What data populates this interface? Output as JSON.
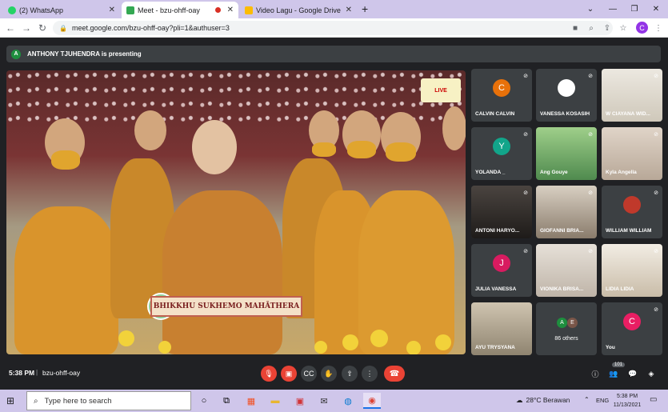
{
  "browser": {
    "tabs": [
      {
        "title": "(2) WhatsApp",
        "icon": "whatsapp-icon",
        "favicon_color": "#25d366",
        "active": false
      },
      {
        "title": "Meet - bzu-ohff-oay",
        "icon": "meet-icon",
        "favicon_color": "#34a853",
        "active": true
      },
      {
        "title": "Video Lagu - Google Drive",
        "icon": "drive-icon",
        "favicon_color": "#fbbc04",
        "active": false
      }
    ],
    "new_tab": "+",
    "url": "meet.google.com/bzu-ohff-oay?pli=1&authuser=3",
    "profile_initial": "C"
  },
  "meet": {
    "presenting": "ANTHONY TJUHENDRA is presenting",
    "presenter_initial": "A",
    "main_video": {
      "live_badge": "LIVE",
      "nameplate": "BHIKKHU SUKHEMO MAHĀTHERA"
    },
    "participants": [
      {
        "name": "CALVIN CALVIN",
        "initial": "C",
        "color": "#e8710a",
        "kind": "avatar"
      },
      {
        "name": "VANESSA KOSASIH",
        "initial": "",
        "color": "#ffffff",
        "kind": "avatar"
      },
      {
        "name": "W CIAYANA WID...",
        "kind": "video",
        "color": "#d8d2c4"
      },
      {
        "name": "YOLANDA _",
        "initial": "Y",
        "color": "#12a58a",
        "kind": "avatar"
      },
      {
        "name": "Ang Gouye",
        "kind": "video",
        "color": "#7fb87a"
      },
      {
        "name": "Kyla Angella",
        "kind": "video",
        "color": "#c9b8a8"
      },
      {
        "name": "ANTONI HARYO...",
        "kind": "video",
        "color": "#2d2a28"
      },
      {
        "name": "GIOFANNI BRIA...",
        "kind": "video",
        "color": "#b8aa98"
      },
      {
        "name": "WILLIAM WILLIAM",
        "kind": "avatar-photo",
        "color": "#c0392b"
      },
      {
        "name": "JULIA VANESSA",
        "initial": "J",
        "color": "#d81b60",
        "kind": "avatar"
      },
      {
        "name": "VIONIKA BRISA...",
        "kind": "video",
        "color": "#d6cfc6"
      },
      {
        "name": "LIDIA LIDIA",
        "kind": "video",
        "color": "#e8e2d8"
      },
      {
        "name": "AYU TRYSYANA",
        "kind": "video",
        "color": "#b7ab96"
      },
      {
        "name": "86 others",
        "initials": [
          "A",
          "E"
        ],
        "kind": "others"
      },
      {
        "name": "You",
        "initial": "C",
        "color": "#e91e63",
        "kind": "avatar"
      }
    ],
    "time": "5:38 PM",
    "meeting_code": "bzu-ohff-oay",
    "participant_count": "101"
  },
  "taskbar": {
    "search_placeholder": "Type here to search",
    "weather": "28°C  Berawan",
    "language": "ENG",
    "clock_time": "5:38 PM",
    "clock_date": "11/13/2021"
  }
}
